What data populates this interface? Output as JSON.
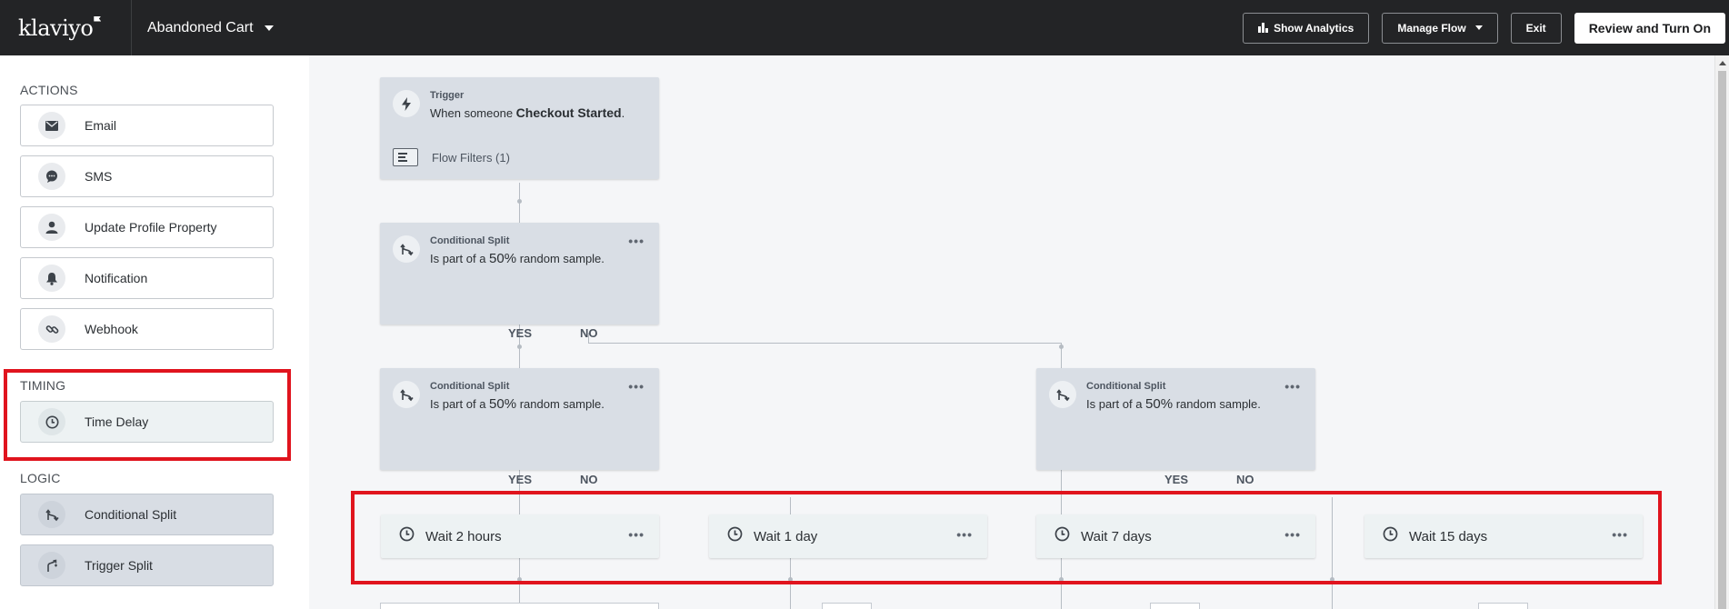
{
  "header": {
    "logo": "klaviyo",
    "flow_name": "Abandoned Cart",
    "show_analytics": "Show Analytics",
    "manage_flow": "Manage Flow",
    "exit": "Exit",
    "review_turn_on": "Review and Turn On"
  },
  "sidebar": {
    "actions_label": "ACTIONS",
    "actions": [
      {
        "label": "Email",
        "icon": "envelope-icon"
      },
      {
        "label": "SMS",
        "icon": "chat-bubble-icon"
      },
      {
        "label": "Update Profile Property",
        "icon": "person-icon"
      },
      {
        "label": "Notification",
        "icon": "bell-icon"
      },
      {
        "label": "Webhook",
        "icon": "link-icon"
      }
    ],
    "timing_label": "TIMING",
    "timing": [
      {
        "label": "Time Delay",
        "icon": "clock-icon"
      }
    ],
    "logic_label": "LOGIC",
    "logic": [
      {
        "label": "Conditional Split",
        "icon": "split-icon"
      },
      {
        "label": "Trigger Split",
        "icon": "trigger-split-icon"
      }
    ]
  },
  "canvas": {
    "trigger": {
      "kicker": "Trigger",
      "text_prefix": "When someone ",
      "event": "Checkout Started",
      "text_suffix": ".",
      "filters": "Flow Filters (1)"
    },
    "splits": [
      {
        "kicker": "Conditional Split",
        "text_prefix": "Is part of a ",
        "percent": "50%",
        "text_suffix": " random sample.",
        "menu": "•••"
      },
      {
        "kicker": "Conditional Split",
        "text_prefix": "Is part of a ",
        "percent": "50%",
        "text_suffix": " random sample.",
        "menu": "•••"
      },
      {
        "kicker": "Conditional Split",
        "text_prefix": "Is part of a ",
        "percent": "50%",
        "text_suffix": " random sample.",
        "menu": "•••"
      }
    ],
    "branch_labels": {
      "yes": "YES",
      "no": "NO"
    },
    "waits": [
      {
        "label": "Wait 2 hours",
        "menu": "•••"
      },
      {
        "label": "Wait 1 day",
        "menu": "•••"
      },
      {
        "label": "Wait 7 days",
        "menu": "•••"
      },
      {
        "label": "Wait 15 days",
        "menu": "•••"
      }
    ]
  },
  "colors": {
    "topbar": "#232426",
    "highlight": "#e0141e",
    "node": "#d9dee5",
    "wait_node": "#edf2f3"
  }
}
